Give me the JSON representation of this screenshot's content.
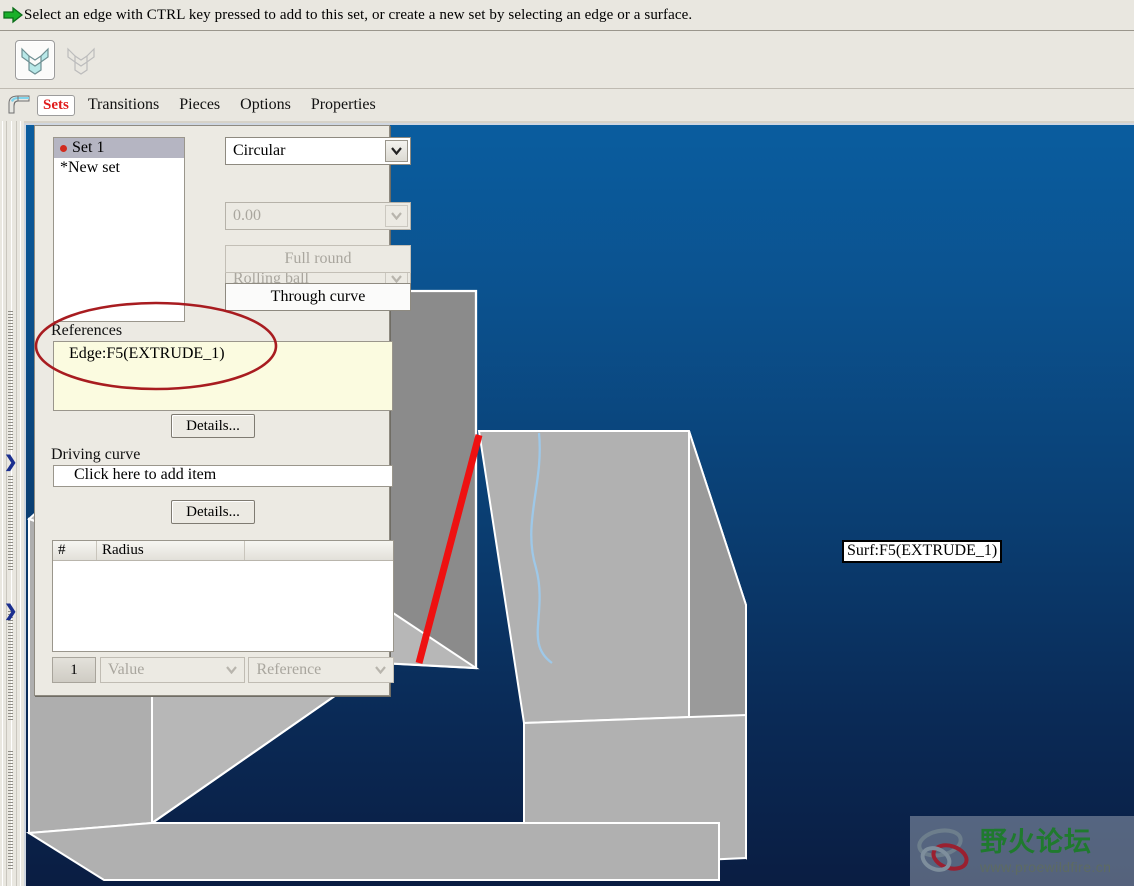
{
  "status": {
    "icon": "green-arrow-icon",
    "message": "Select an edge with CTRL key pressed to add to this set, or create a new set by selecting an edge or a surface."
  },
  "toolbar": {
    "buttons": [
      {
        "name": "round-sets-tool",
        "icon": "round-set-icon",
        "active": true
      },
      {
        "name": "transitions-tool",
        "icon": "transition-set-icon",
        "active": false
      }
    ]
  },
  "tabs": {
    "feature_icon": "round-feature-icon",
    "items": [
      {
        "label": "Sets",
        "selected": true
      },
      {
        "label": "Transitions",
        "selected": false
      },
      {
        "label": "Pieces",
        "selected": false
      },
      {
        "label": "Options",
        "selected": false
      },
      {
        "label": "Properties",
        "selected": false
      }
    ]
  },
  "panel": {
    "sets_list": [
      {
        "label": "Set 1",
        "selected": true,
        "marker": "dot"
      },
      {
        "label": "*New set",
        "selected": false,
        "marker": "none"
      }
    ],
    "type_combo": {
      "value": "Circular",
      "enabled": true
    },
    "value_combo": {
      "value": "0.00",
      "enabled": false
    },
    "shape_combo": {
      "value": "Rolling ball",
      "enabled": false
    },
    "full_round_button": {
      "label": "Full round",
      "enabled": false
    },
    "through_curve_button": {
      "label": "Through curve",
      "enabled": true
    },
    "references": {
      "label": "References",
      "items": [
        "Edge:F5(EXTRUDE_1)"
      ],
      "details_label": "Details..."
    },
    "driving_curve": {
      "label": "Driving curve",
      "placeholder": "Click here to add item",
      "details_label": "Details..."
    },
    "radius_table": {
      "columns": [
        "#",
        "Radius",
        ""
      ],
      "rows": []
    },
    "radius_footer": {
      "index": "1",
      "value_combo": "Value",
      "reference_combo": "Reference"
    }
  },
  "annotations": {
    "ellipse_color": "#a81c20",
    "ellipse_target": "references-section"
  },
  "viewport": {
    "background_top": "#0a5d9f",
    "background_bottom": "#0a1d42",
    "model_face_color": "#a8a8a8",
    "highlighted_edge_color": "#ee1111",
    "curve_color": "#9ec8e8",
    "surface_label": "Surf:F5(EXTRUDE_1)",
    "coord_triad": {
      "x_axis_color": "#7b0e2e",
      "y_axis_color": "#11cc11",
      "z_axis_color": "#5aa8e0"
    }
  },
  "dock": {
    "chevrons": [
      "chevron-right-icon",
      "chevron-right-icon"
    ]
  },
  "watermark": {
    "title": "野火论坛",
    "url": "www.proewildfire.cn",
    "logo": "infinity-loop-logo"
  }
}
